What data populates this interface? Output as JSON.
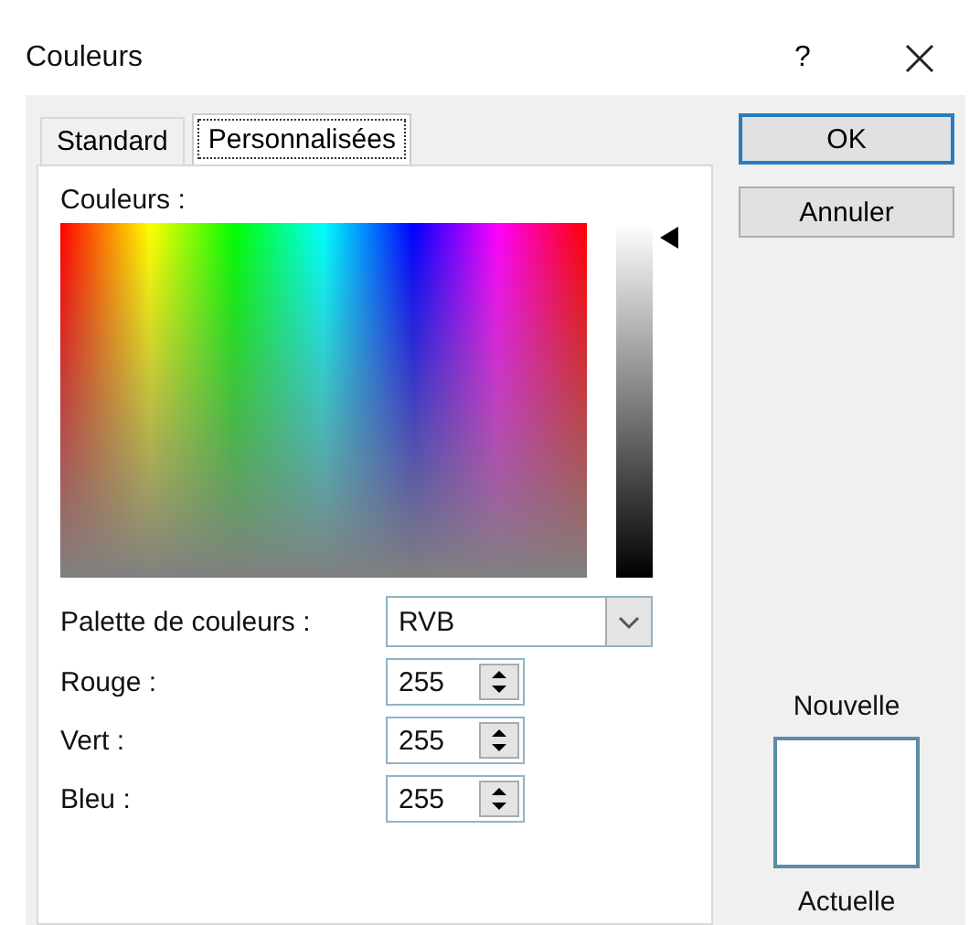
{
  "window": {
    "title": "Couleurs",
    "help": "?"
  },
  "tabs": [
    {
      "label": "Standard",
      "selected": false
    },
    {
      "label": "Personnalisées",
      "selected": true
    }
  ],
  "colors_label": "Couleurs :",
  "palette": {
    "label": "Palette de couleurs :",
    "value": "RVB"
  },
  "channels": [
    {
      "label": "Rouge :",
      "value": "255"
    },
    {
      "label": "Vert :",
      "value": "255"
    },
    {
      "label": "Bleu :",
      "value": "255"
    }
  ],
  "buttons": [
    {
      "label": "OK",
      "default": true
    },
    {
      "label": "Annuler",
      "default": false
    }
  ],
  "preview": {
    "new_label": "Nouvelle",
    "current_label": "Actuelle"
  }
}
